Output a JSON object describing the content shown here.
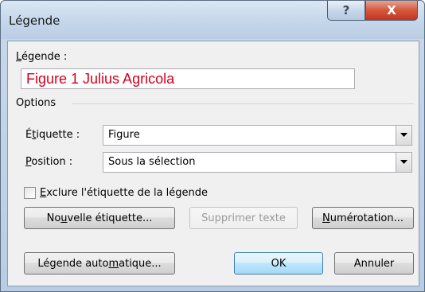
{
  "window": {
    "title": "Légende"
  },
  "titlebar": {
    "help_glyph": "?",
    "close_glyph": "X"
  },
  "caption": {
    "label": "Légende :",
    "value": "Figure 1 Julius Agricola",
    "value_color": "#d6001c"
  },
  "options": {
    "group_label": "Options",
    "label_field": {
      "label": "Étiquette :",
      "value": "Figure"
    },
    "position_field": {
      "label": "Position :",
      "value": "Sous la sélection"
    },
    "exclude_checkbox": {
      "label": "Exclure l'étiquette de la légende",
      "checked": false
    }
  },
  "buttons": {
    "new_label": "Nouvelle étiquette...",
    "delete_label": "Supprimer texte",
    "numbering": "Numérotation...",
    "autocaption": "Légende automatique...",
    "ok": "OK",
    "cancel": "Annuler"
  }
}
